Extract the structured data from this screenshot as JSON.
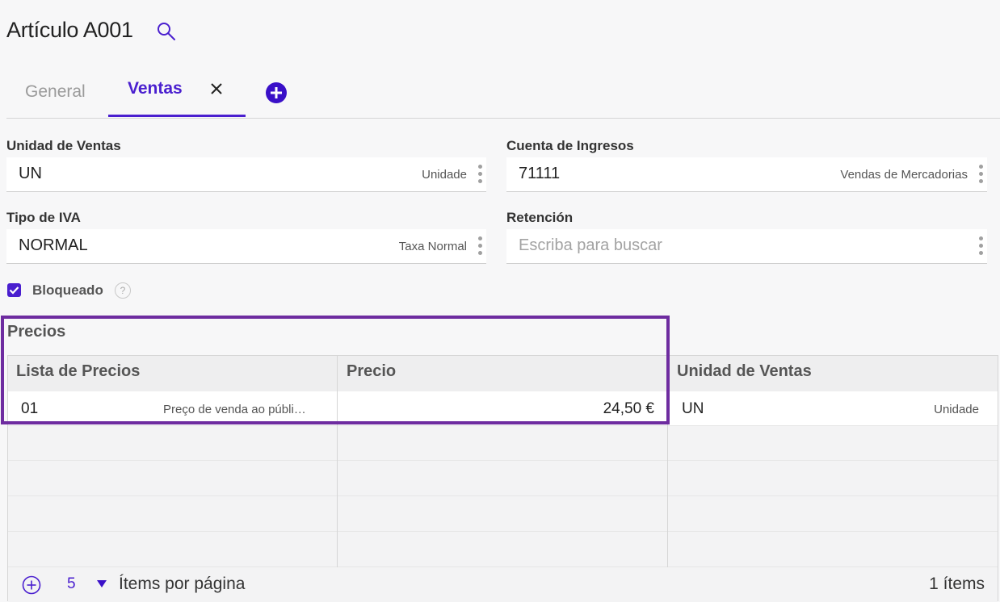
{
  "page": {
    "title": "Artículo A001"
  },
  "tabs": [
    {
      "label": "General"
    },
    {
      "label": "Ventas"
    }
  ],
  "fields": {
    "unidad_ventas": {
      "label": "Unidad de Ventas",
      "value": "UN",
      "description": "Unidade"
    },
    "cuenta_ingresos": {
      "label": "Cuenta de Ingresos",
      "value": "71111",
      "description": "Vendas de Mercadorias"
    },
    "tipo_iva": {
      "label": "Tipo de IVA",
      "value": "NORMAL",
      "description": "Taxa Normal"
    },
    "retencion": {
      "label": "Retención",
      "value": "",
      "placeholder": "Escriba para buscar"
    }
  },
  "bloqueado": {
    "label": "Bloqueado",
    "checked": true,
    "help": "?"
  },
  "precios": {
    "title": "Precios",
    "columns": [
      "Lista de Precios",
      "Precio",
      "Unidad de Ventas"
    ],
    "rows": [
      {
        "lista": "01",
        "lista_desc": "Preço de venda ao públi…",
        "precio": "24,50 €",
        "unidad": "UN",
        "unidad_desc": "Unidade"
      }
    ],
    "pagination": {
      "page_size": "5",
      "page_label": "Ítems por página",
      "count": "1 ítems"
    }
  },
  "colors": {
    "accent": "#4a1fcf",
    "highlight": "#6e2ca0"
  },
  "icons": [
    "search-icon",
    "close-icon",
    "plus-circle-icon",
    "kebab-icon",
    "check-icon",
    "help-icon",
    "caret-down-icon",
    "plus-circle-outline-icon"
  ]
}
